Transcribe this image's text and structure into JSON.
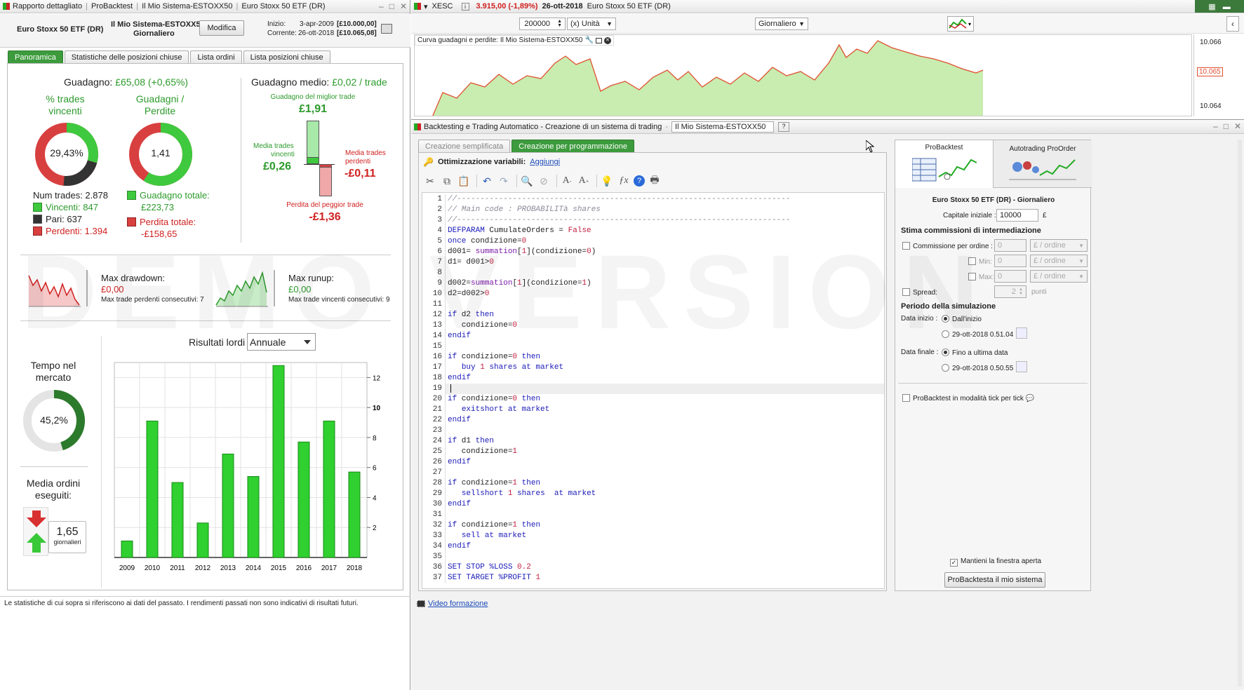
{
  "left_window": {
    "title_items": [
      "Rapporto dettagliato",
      "ProBacktest",
      "Il Mio Sistema-ESTOXX50",
      "Euro Stoxx 50 ETF (DR)"
    ],
    "instrument": "Euro Stoxx 50 ETF (DR)",
    "system_name": "Il Mio Sistema-ESTOXX50",
    "timeframe": "Giornaliero",
    "modify_label": "Modifica",
    "start_label": "Inizio:",
    "start_date": "3-apr-2009",
    "start_value": "[£10.000,00]",
    "current_label": "Corrente:",
    "current_date": "26-ott-2018",
    "current_value": "[£10.065,08]",
    "tabs": [
      "Panoramica",
      "Statistiche delle posizioni chiuse",
      "Lista ordini",
      "Lista posizioni chiuse"
    ],
    "gain_label": "Guadagno:",
    "gain_value": "£65,08 (+0,65%)",
    "win_pct_title_1": "% trades",
    "win_pct_title_2": "vincenti",
    "win_pct_value": "29,43%",
    "win_pct_fraction": 0.2943,
    "gp_title_1": "Guadagni /",
    "gp_title_2": "Perdite",
    "gp_value": "1,41",
    "num_trades": "Num trades: 2.878",
    "winners": "Vincenti: 847",
    "ties": "Pari: 637",
    "losers": "Perdenti: 1.394",
    "total_gain_label": "Guadagno totale:",
    "total_gain_value": "£223,73",
    "total_loss_label": "Perdita totale:",
    "total_loss_value": "-£158,65",
    "avg_gain_label": "Guadagno medio:",
    "avg_gain_value": "£0,02 / trade",
    "best_trade_label": "Guadagno del miglior trade",
    "best_trade_value": "£1,91",
    "avg_win_label_1": "Media trades",
    "avg_win_label_2": "vincenti",
    "avg_win_value": "£0,26",
    "avg_loss_label_1": "Media trades",
    "avg_loss_label_2": "perdenti",
    "avg_loss_value": "-£0,11",
    "worst_trade_label": "Perdita del peggior trade",
    "worst_trade_value": "-£1,36",
    "max_drawdown_label": "Max drawdown:",
    "max_drawdown_value": "£0,00",
    "max_losing_consec": "Max trade perdenti consecutivi:  7",
    "max_runup_label": "Max runup:",
    "max_runup_value": "£0,00",
    "max_winning_consec": "Max trade vincenti consecutivi: 9",
    "results_label": "Risultati lordi",
    "results_period": "Annuale",
    "time_market_1": "Tempo nel",
    "time_market_2": "mercato",
    "time_market_value": "45,2%",
    "time_market_fraction": 0.452,
    "avg_orders_1": "Media ordini",
    "avg_orders_2": "eseguiti:",
    "avg_orders_value": "1,65",
    "avg_orders_unit": "giornalieri",
    "footer_note": "Le statistiche di cui sopra si riferiscono ai dati del passato. I rendimenti passati non sono indicativi di risultati futuri."
  },
  "chart_data": {
    "type": "bar",
    "categories": [
      "2009",
      "2010",
      "2011",
      "2012",
      "2013",
      "2014",
      "2015",
      "2016",
      "2017",
      "2018"
    ],
    "values": [
      1.1,
      9.1,
      5.0,
      2.3,
      6.9,
      5.4,
      12.8,
      7.7,
      9.1,
      5.7
    ],
    "title": "",
    "xlabel": "",
    "ylabel": "",
    "ylim": [
      0,
      13
    ],
    "yticks": [
      "2",
      "4",
      "6",
      "8",
      "10",
      "12"
    ],
    "grid": true,
    "legend": "none"
  },
  "chart_window": {
    "symbol": "XESC",
    "price": "3.915,00 (-1,89%)",
    "date": "26-ott-2018",
    "instrument": "Euro Stoxx 50 ETF (DR)",
    "quantity": "200000",
    "unit": "(x) Unità",
    "timeframe": "Giornaliero",
    "curve_label": "Curva guadagni e perdite: Il Mio Sistema-ESTOXX50",
    "price_ticks": [
      "10.066",
      "10.065",
      "10.064"
    ]
  },
  "editor_window": {
    "title": "Backtesting e Trading Automatico - Creazione di un sistema di trading",
    "system_name": "Il Mio Sistema-ESTOXX50",
    "tabs": [
      "Creazione semplificata",
      "Creazione per programmazione"
    ],
    "optimization_label": "Ottimizzazione variabili:",
    "add_link": "Aggiungi",
    "video_link": "Video formazione",
    "code_lines": [
      [
        [
          "cm",
          "//------------------------------------------------------------------------"
        ]
      ],
      [
        [
          "cm",
          "// Main code : PROBABILITà shares"
        ]
      ],
      [
        [
          "cm",
          "//------------------------------------------------------------------------"
        ]
      ],
      [
        [
          "kw",
          "DEFPARAM"
        ],
        [
          "tx",
          " CumulateOrders = "
        ],
        [
          "nm",
          "False"
        ]
      ],
      [
        [
          "kw",
          "once"
        ],
        [
          "tx",
          " condizione="
        ],
        [
          "nm",
          "0"
        ]
      ],
      [
        [
          "tx",
          "d001= "
        ],
        [
          "fn",
          "summation"
        ],
        [
          "tx",
          "["
        ],
        [
          "nm",
          "1"
        ],
        [
          "tx",
          "](condizione="
        ],
        [
          "nm",
          "0"
        ],
        [
          "tx",
          ")"
        ]
      ],
      [
        [
          "tx",
          "d1= d001>"
        ],
        [
          "nm",
          "0"
        ]
      ],
      [],
      [
        [
          "tx",
          "d002="
        ],
        [
          "fn",
          "summation"
        ],
        [
          "tx",
          "["
        ],
        [
          "nm",
          "1"
        ],
        [
          "tx",
          "](condizione="
        ],
        [
          "nm",
          "1"
        ],
        [
          "tx",
          ")"
        ]
      ],
      [
        [
          "tx",
          "d2=d002>"
        ],
        [
          "nm",
          "0"
        ]
      ],
      [],
      [
        [
          "kw",
          "if"
        ],
        [
          "tx",
          " d2 "
        ],
        [
          "kw",
          "then"
        ]
      ],
      [
        [
          "tx",
          "   condizione="
        ],
        [
          "nm",
          "0"
        ]
      ],
      [
        [
          "kw",
          "endif"
        ]
      ],
      [],
      [
        [
          "kw",
          "if"
        ],
        [
          "tx",
          " condizione="
        ],
        [
          "nm",
          "0"
        ],
        [
          "tx",
          " "
        ],
        [
          "kw",
          "then"
        ]
      ],
      [
        [
          "tx",
          "   "
        ],
        [
          "kw",
          "buy"
        ],
        [
          "tx",
          " "
        ],
        [
          "nm",
          "1"
        ],
        [
          "tx",
          " "
        ],
        [
          "kw",
          "shares at market"
        ]
      ],
      [
        [
          "kw",
          "endif"
        ]
      ],
      [],
      [
        [
          "kw",
          "if"
        ],
        [
          "tx",
          " condizione="
        ],
        [
          "nm",
          "0"
        ],
        [
          "tx",
          " "
        ],
        [
          "kw",
          "then"
        ]
      ],
      [
        [
          "tx",
          "   "
        ],
        [
          "kw",
          "exitshort at market"
        ]
      ],
      [
        [
          "kw",
          "endif"
        ]
      ],
      [],
      [
        [
          "kw",
          "if"
        ],
        [
          "tx",
          " d1 "
        ],
        [
          "kw",
          "then"
        ]
      ],
      [
        [
          "tx",
          "   condizione="
        ],
        [
          "nm",
          "1"
        ]
      ],
      [
        [
          "kw",
          "endif"
        ]
      ],
      [],
      [
        [
          "kw",
          "if"
        ],
        [
          "tx",
          " condizione="
        ],
        [
          "nm",
          "1"
        ],
        [
          "tx",
          " "
        ],
        [
          "kw",
          "then"
        ]
      ],
      [
        [
          "tx",
          "   "
        ],
        [
          "kw",
          "sellshort"
        ],
        [
          "tx",
          " "
        ],
        [
          "nm",
          "1"
        ],
        [
          "tx",
          " "
        ],
        [
          "kw",
          "shares  at market"
        ]
      ],
      [
        [
          "kw",
          "endif"
        ]
      ],
      [],
      [
        [
          "kw",
          "if"
        ],
        [
          "tx",
          " condizione="
        ],
        [
          "nm",
          "1"
        ],
        [
          "tx",
          " "
        ],
        [
          "kw",
          "then"
        ]
      ],
      [
        [
          "tx",
          "   "
        ],
        [
          "kw",
          "sell at market"
        ]
      ],
      [
        [
          "kw",
          "endif"
        ]
      ],
      [],
      [
        [
          "kw",
          "SET STOP"
        ],
        [
          "tx",
          " "
        ],
        [
          "kw",
          "%LOSS"
        ],
        [
          "tx",
          " "
        ],
        [
          "nm",
          "0.2"
        ]
      ],
      [
        [
          "kw",
          "SET TARGET"
        ],
        [
          "tx",
          " "
        ],
        [
          "kw",
          "%PROFIT"
        ],
        [
          "tx",
          " "
        ],
        [
          "nm",
          "1"
        ]
      ]
    ]
  },
  "backtest_panel": {
    "tab_probacktest": "ProBacktest",
    "tab_autotrading": "Autotrading ProOrder",
    "instrument_tf": "Euro Stoxx 50 ETF (DR) - Giornaliero",
    "initial_capital_label": "Capitale iniziale :",
    "initial_capital_value": "10000",
    "currency": "£",
    "commission_section": "Stima commissioni di intermediazione",
    "commission_per_order": "Commissione per ordine :",
    "commission_value": "0",
    "per_order_unit": "£ / ordine",
    "min_label": "Min:",
    "max_label": "Max:",
    "spread_label": "Spread:",
    "spread_value": "2",
    "points_label": "punti",
    "period_section": "Periodo della simulazione",
    "start_label": "Data inizio :",
    "start_option_1": "Dall'inizio",
    "start_option_2": "29-ott-2018 0.51.04",
    "end_label": "Data finale :",
    "end_option_1": "Fino a ultima data",
    "end_option_2": "29-ott-2018 0.50.55",
    "tick_mode_label": "ProBacktest in modalità tick per tick",
    "keep_open_label": "Mantieni la finestra aperta",
    "run_button": "ProBacktesta il mio sistema"
  },
  "watermark": "DEMO VERSION",
  "colors": {
    "green": "#2c9a2c",
    "red": "#d02020",
    "tab_green": "#3d9b3d",
    "bar_green": "#2fd02f"
  }
}
